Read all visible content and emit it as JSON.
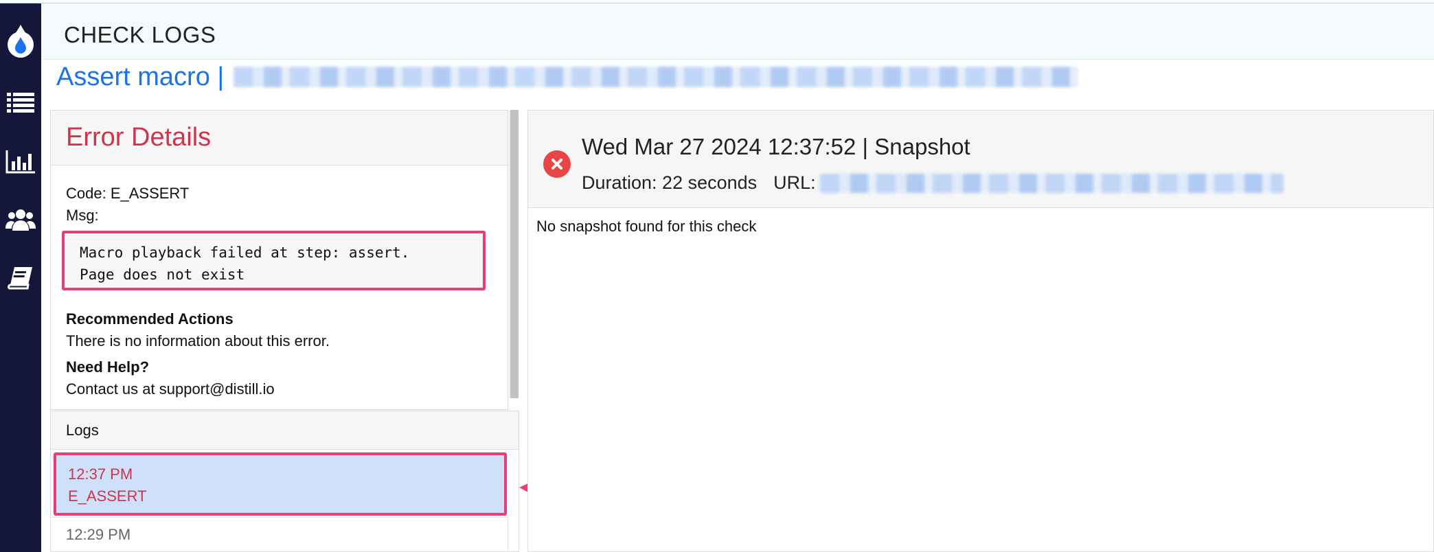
{
  "header": {
    "title": "CHECK LOGS"
  },
  "subtitle": {
    "prefix": "Assert macro |"
  },
  "sidebar": {
    "items": [
      {
        "name": "logo",
        "icon": "drop-icon"
      },
      {
        "name": "list",
        "icon": "list-icon"
      },
      {
        "name": "reports",
        "icon": "bar-chart-icon"
      },
      {
        "name": "users",
        "icon": "users-icon"
      },
      {
        "name": "docs",
        "icon": "book-icon"
      }
    ]
  },
  "error": {
    "heading": "Error Details",
    "code_line": "Code: E_ASSERT",
    "msg_label": "Msg:",
    "msg_line1": "Macro playback failed at step: assert.",
    "msg_line2": "Page does not exist",
    "recommended_heading": "Recommended Actions",
    "recommended_text": "There is no information about this error.",
    "help_heading": "Need Help?",
    "help_text": "Contact us at support@distill.io"
  },
  "logs": {
    "heading": "Logs",
    "items": [
      {
        "time": "12:37 PM",
        "code": "E_ASSERT",
        "selected": true
      },
      {
        "time": "12:29 PM",
        "code": "",
        "selected": false
      }
    ]
  },
  "snapshot": {
    "title": "Wed Mar 27 2024 12:37:52 | Snapshot",
    "duration": "Duration: 22 seconds",
    "url_label": "URL:",
    "message": "No snapshot found for this check"
  },
  "colors": {
    "sidebar_bg": "#14173a",
    "error_red": "#d0344a",
    "link_blue": "#1a73e8",
    "highlight_pink": "#e83e74",
    "selected_bg": "#cfe0fb"
  }
}
